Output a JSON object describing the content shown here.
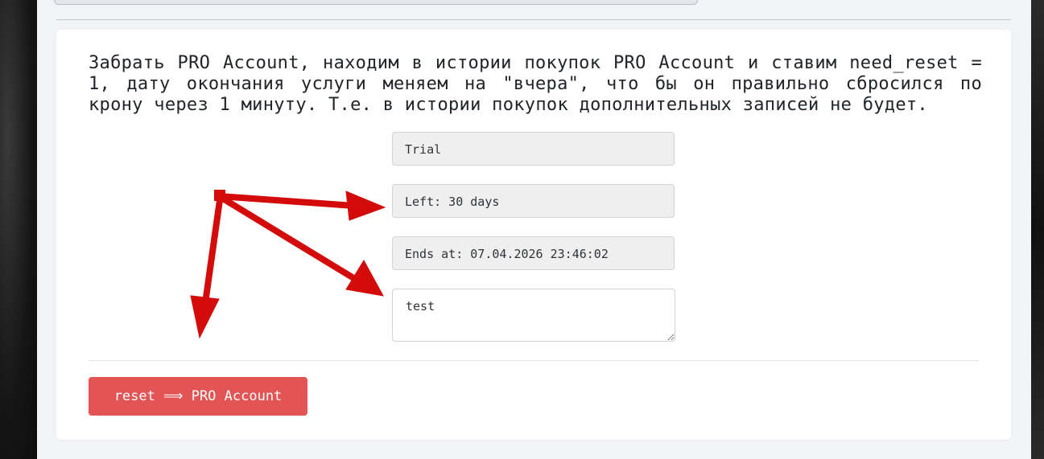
{
  "description": "Забрать PRO Account, находим в истории покупок PRO Account и ставим need_reset = 1, дату окончания услуги меняем на \"вчера\", что бы он правильно сбросился по крону через 1 минуту. Т.е. в истории покупок дополнительных записей не будет.",
  "fields": {
    "plan": "Trial",
    "left": "Left: 30 days",
    "ends_at": "Ends at: 07.04.2026 23:46:02"
  },
  "notes": {
    "value": "test"
  },
  "reset_button": {
    "label": "reset ⟹ PRO Account"
  },
  "colors": {
    "annotation_arrow": "#d40b0b",
    "danger_button": "#e35454"
  }
}
